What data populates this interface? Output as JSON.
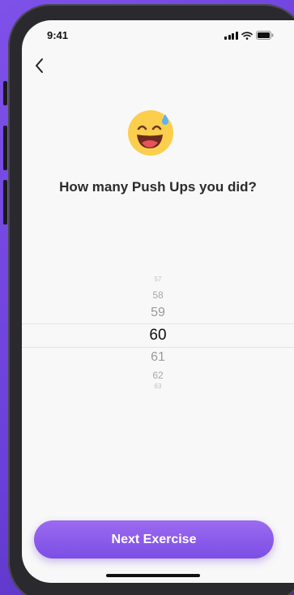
{
  "status_bar": {
    "time": "9:41"
  },
  "question": "How many Push Ups you did?",
  "picker": {
    "selected": "60",
    "items": [
      "57",
      "58",
      "59",
      "60",
      "61",
      "62",
      "63"
    ]
  },
  "next_button_label": "Next Exercise",
  "colors": {
    "accent": "#8a5ae9",
    "background": "#7e52e8",
    "screen": "#f8f8f8",
    "emoji": "#fbcf4d"
  },
  "icons": {
    "back": "chevron-left-icon",
    "emoji": "grinning-sweat-emoji-icon",
    "signal": "cellular-signal-icon",
    "wifi": "wifi-icon",
    "battery": "battery-icon"
  }
}
